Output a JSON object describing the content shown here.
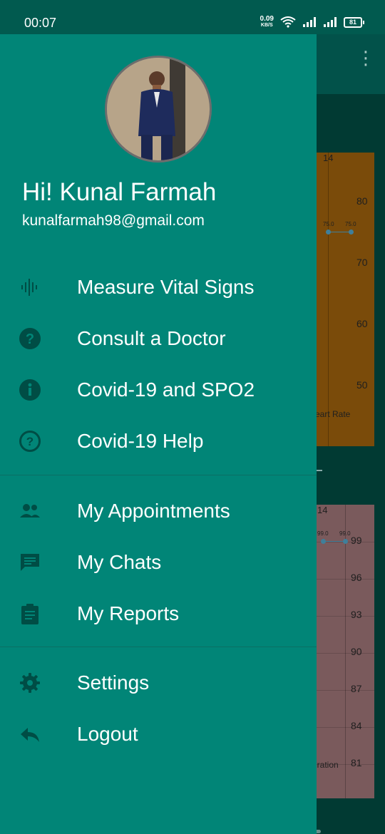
{
  "status_bar": {
    "time": "00:07",
    "speed_value": "0.09",
    "speed_unit": "KB/S",
    "battery": "81"
  },
  "drawer": {
    "greeting": "Hi! Kunal Farmah",
    "email": "kunalfarmah98@gmail.com",
    "items": [
      {
        "label": "Measure Vital Signs",
        "icon": "waveform-icon"
      },
      {
        "label": "Consult a Doctor",
        "icon": "help-circle-icon"
      },
      {
        "label": "Covid-19 and SPO2",
        "icon": "info-icon"
      },
      {
        "label": "Covid-19 Help",
        "icon": "help-outline-icon"
      },
      {
        "label": "My Appointments",
        "icon": "people-icon"
      },
      {
        "label": "My Chats",
        "icon": "chat-icon"
      },
      {
        "label": "My Reports",
        "icon": "clipboard-icon"
      },
      {
        "label": "Settings",
        "icon": "gear-icon"
      },
      {
        "label": "Logout",
        "icon": "reply-icon"
      }
    ]
  },
  "background_charts": {
    "heart": {
      "top_tick": "14",
      "ticks": [
        "80",
        "70",
        "60",
        "50"
      ],
      "point_labels": [
        "75.0",
        "75.0"
      ],
      "label": "eart Rate"
    },
    "spo2": {
      "top_tick": "14",
      "ticks": [
        "99",
        "96",
        "93",
        "90",
        "87",
        "84",
        "81"
      ],
      "point_labels": [
        "99.0",
        "99.0"
      ],
      "label": "uration"
    }
  },
  "colors": {
    "drawer_bg": "#018577",
    "icon_color": "#004d45",
    "status_bar": "#015a4f"
  }
}
